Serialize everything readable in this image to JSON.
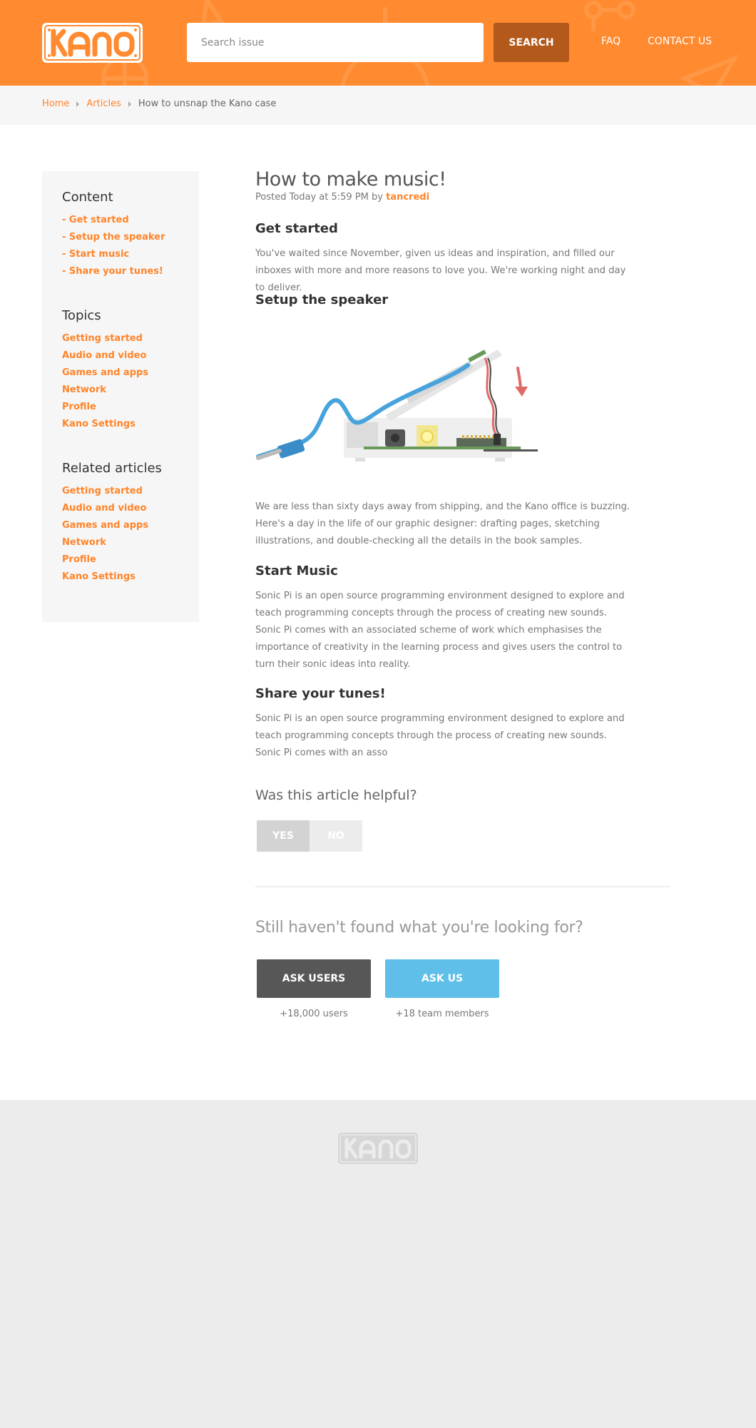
{
  "header": {
    "logo_text": "KANO",
    "search_placeholder": "Search issue",
    "search_button": "SEARCH",
    "nav": {
      "faq": "FAQ",
      "contact": "CONTACT US"
    }
  },
  "breadcrumb": {
    "home": "Home",
    "articles": "Articles",
    "current": "How to unsnap the Kano case"
  },
  "sidebar": {
    "content": {
      "title": "Content",
      "items": [
        "- Get started",
        "- Setup the speaker",
        "- Start music",
        "- Share your tunes!"
      ]
    },
    "topics": {
      "title": "Topics",
      "items": [
        "Getting started",
        "Audio and video",
        "Games and apps",
        "Network",
        "Profile",
        "Kano Settings"
      ]
    },
    "related": {
      "title": "Related articles",
      "items": [
        "Getting started",
        "Audio and video",
        "Games and apps",
        "Network",
        "Profile",
        "Kano Settings"
      ]
    }
  },
  "article": {
    "title": "How to make music!",
    "meta_prefix": "Posted Today at 5:59 PM by",
    "author": "tancredi",
    "sections": [
      {
        "heading": "Get started",
        "text": "You've waited since November, given us ideas and inspiration, and filled our inboxes with more and more reasons to love you. We're working night and day to deliver."
      },
      {
        "heading": "Setup the speaker",
        "text": "We are less than sixty days away from shipping, and the Kano office is buzzing. Here's a day in the life of our graphic designer: drafting pages, sketching illustrations, and double-checking all the details in the book samples."
      },
      {
        "heading": "Start Music",
        "text": "Sonic Pi is an open source programming environment designed to explore and teach programming concepts through the process of creating new sounds. Sonic Pi comes with an associated scheme of work which emphasises the importance of creativity in the learning process and gives users the control to turn their sonic ideas into reality."
      },
      {
        "heading": "Share your tunes!",
        "text": "Sonic Pi is an open source programming environment designed to explore and teach programming concepts through the process of creating new sounds. Sonic Pi comes with an asso"
      }
    ]
  },
  "feedback": {
    "question": "Was this article helpful?",
    "yes": "YES",
    "no": "NO"
  },
  "help": {
    "title": "Still haven't found what you're looking for?",
    "ask_users": "ASK USERS",
    "ask_users_caption": "+18,000 users",
    "ask_us": "ASK US",
    "ask_us_caption": "+18 team members"
  },
  "footer": {
    "logo_text": "KANO"
  },
  "colors": {
    "brand_orange": "#ff8a2f",
    "link_orange": "#ff842a",
    "search_button": "#b3591b",
    "ask_users": "#575757",
    "ask_us": "#5fbfe8"
  }
}
